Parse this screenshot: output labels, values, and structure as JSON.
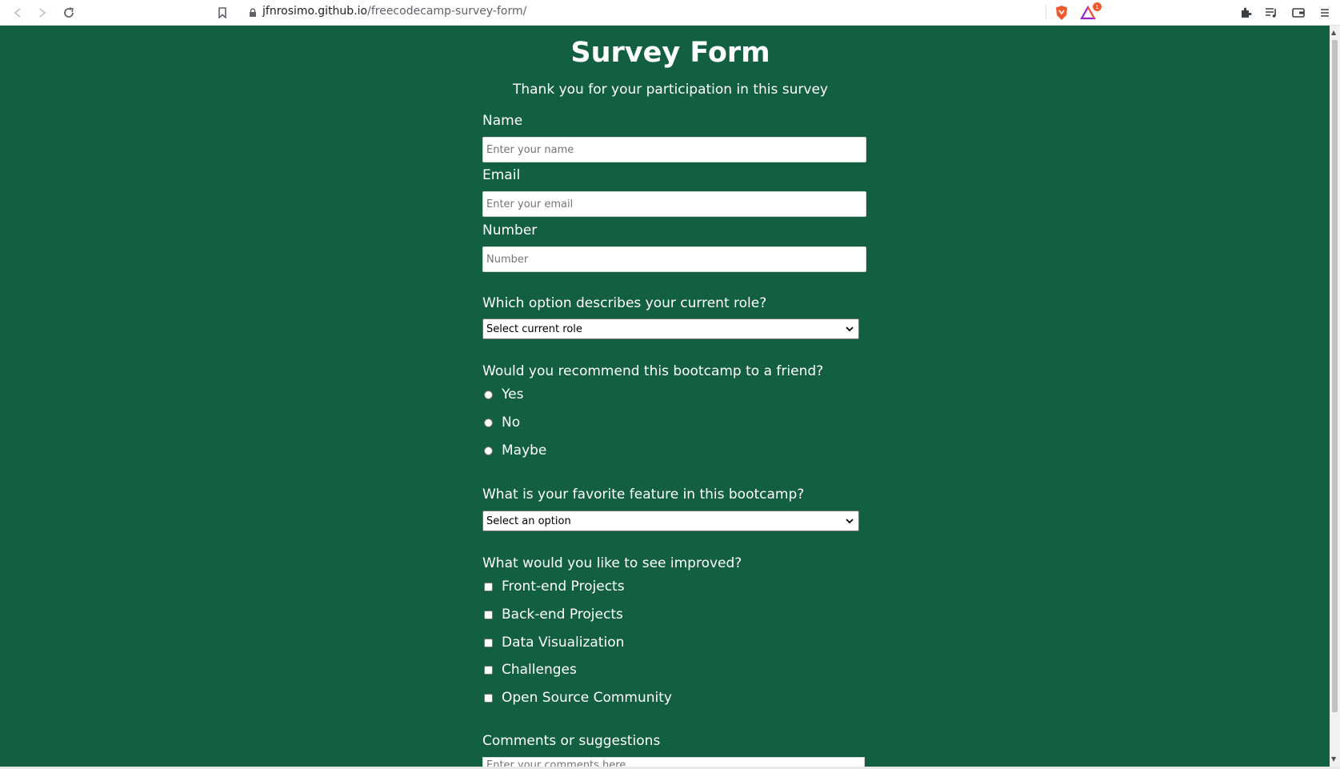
{
  "browser": {
    "url_host": "jfnrosimo.github.io",
    "url_path": "/freecodecamp-survey-form/",
    "shields_badge": "1",
    "accent_color": "#f0592e"
  },
  "page": {
    "background_color": "#126041",
    "title": "Survey Form",
    "description": "Thank you for your participation in this survey"
  },
  "form": {
    "name_label": "Name",
    "name_placeholder": "Enter your name",
    "email_label": "Email",
    "email_placeholder": "Enter your email",
    "number_label": "Number",
    "number_placeholder": "Number",
    "role_question": "Which option describes your current role?",
    "role_selected": "Select current role",
    "recommend_question": "Would you recommend this bootcamp to a friend?",
    "recommend_options": [
      "Yes",
      "No",
      "Maybe"
    ],
    "feature_question": "What is your favorite feature in this bootcamp?",
    "feature_selected": "Select an option",
    "improve_question": "What would you like to see improved?",
    "improve_options": [
      "Front-end Projects",
      "Back-end Projects",
      "Data Visualization",
      "Challenges",
      "Open Source Community"
    ],
    "comments_label": "Comments or suggestions",
    "comments_placeholder": "Enter your comments here"
  }
}
